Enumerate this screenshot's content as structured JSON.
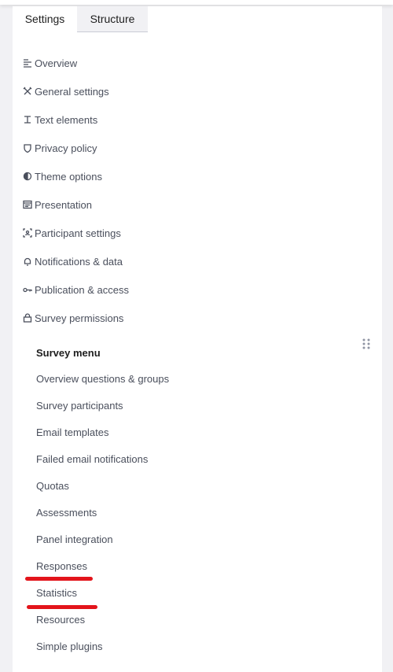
{
  "tabs": [
    {
      "label": "Settings"
    },
    {
      "label": "Structure"
    }
  ],
  "settings": {
    "items": [
      {
        "label": "Overview",
        "icon": "list-lines-icon"
      },
      {
        "label": "General settings",
        "icon": "tools-icon"
      },
      {
        "label": "Text elements",
        "icon": "text-cursor-icon"
      },
      {
        "label": "Privacy policy",
        "icon": "shield-icon"
      },
      {
        "label": "Theme options",
        "icon": "contrast-icon"
      },
      {
        "label": "Presentation",
        "icon": "presentation-window-icon"
      },
      {
        "label": "Participant settings",
        "icon": "participant-scan-icon"
      },
      {
        "label": "Notifications & data",
        "icon": "bell-icon"
      },
      {
        "label": "Publication & access",
        "icon": "key-icon"
      },
      {
        "label": "Survey permissions",
        "icon": "lock-icon"
      }
    ]
  },
  "survey_menu": {
    "title": "Survey menu",
    "items": [
      {
        "label": "Overview questions & groups"
      },
      {
        "label": "Survey participants"
      },
      {
        "label": "Email templates"
      },
      {
        "label": "Failed email notifications"
      },
      {
        "label": "Quotas"
      },
      {
        "label": "Assessments"
      },
      {
        "label": "Panel integration"
      },
      {
        "label": "Responses"
      },
      {
        "label": "Statistics"
      },
      {
        "label": "Resources"
      },
      {
        "label": "Simple plugins"
      }
    ]
  },
  "annotation_color": "#e3141b"
}
